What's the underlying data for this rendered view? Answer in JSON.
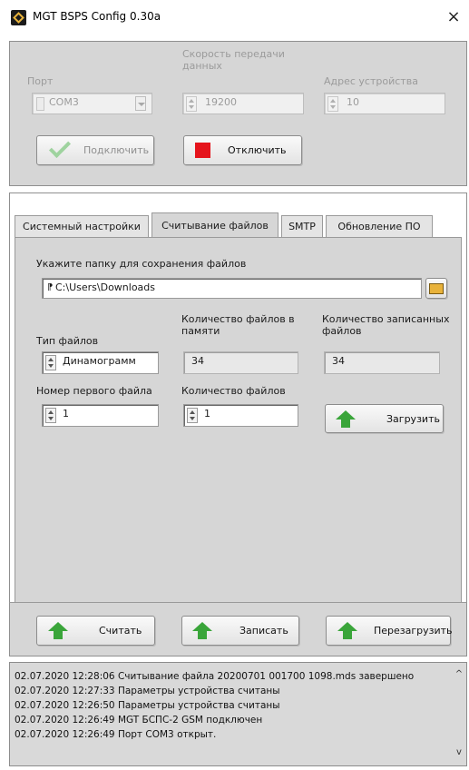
{
  "window": {
    "title": "MGT BSPS Config 0.30a",
    "close_glyph": "×"
  },
  "connection": {
    "port_label": "Порт",
    "port_value": "COM3",
    "speed_label": "Скорость передачи данных",
    "speed_value": "19200",
    "address_label": "Адрес устройства",
    "address_value": "10",
    "connect_label": "Подключить",
    "disconnect_label": "Отключить"
  },
  "tabs": [
    {
      "label": "Системный настройки"
    },
    {
      "label": "Считывание файлов",
      "active": true
    },
    {
      "label": "SMTP"
    },
    {
      "label": "Обновление ПО"
    }
  ],
  "files": {
    "folder_label": "Укажите папку для сохранения файлов",
    "folder_path": "C:\\Users\\Downloads",
    "file_type_label": "Тип файлов",
    "file_type_value": "Динамограмм",
    "files_in_memory_label": "Количество файлов в памяти",
    "files_in_memory_value": "34",
    "files_written_label": "Количество записанных файлов",
    "files_written_value": "34",
    "first_file_label": "Номер первого файла",
    "first_file_value": "1",
    "file_count_label": "Количество файлов",
    "file_count_value": "1",
    "load_label": "Загрузить"
  },
  "actions": {
    "read_label": "Считать",
    "write_label": "Записать",
    "reboot_label": "Перезагрузить"
  },
  "log": {
    "lines": [
      "02.07.2020 12:28:06 Считывание файла 20200701 001700 1098.mds завершено",
      "02.07.2020 12:27:33 Параметры устройства считаны",
      "02.07.2020 12:26:50 Параметры устройства считаны",
      "02.07.2020 12:26:49 MGT БСПС-2 GSM подключен",
      "02.07.2020 12:26:49 Порт COM3 открыт."
    ],
    "scroll_up": "^",
    "scroll_down": "v"
  },
  "icons": {
    "app": "app-logo-icon",
    "close": "close-icon",
    "upload": "green-arrow-up-icon",
    "stop": "red-square-icon",
    "check": "check-icon",
    "folder": "folder-icon"
  },
  "colors": {
    "panel": "#d6d6d6",
    "accent_green": "#3aa53a",
    "stop_red": "#e5141c"
  }
}
